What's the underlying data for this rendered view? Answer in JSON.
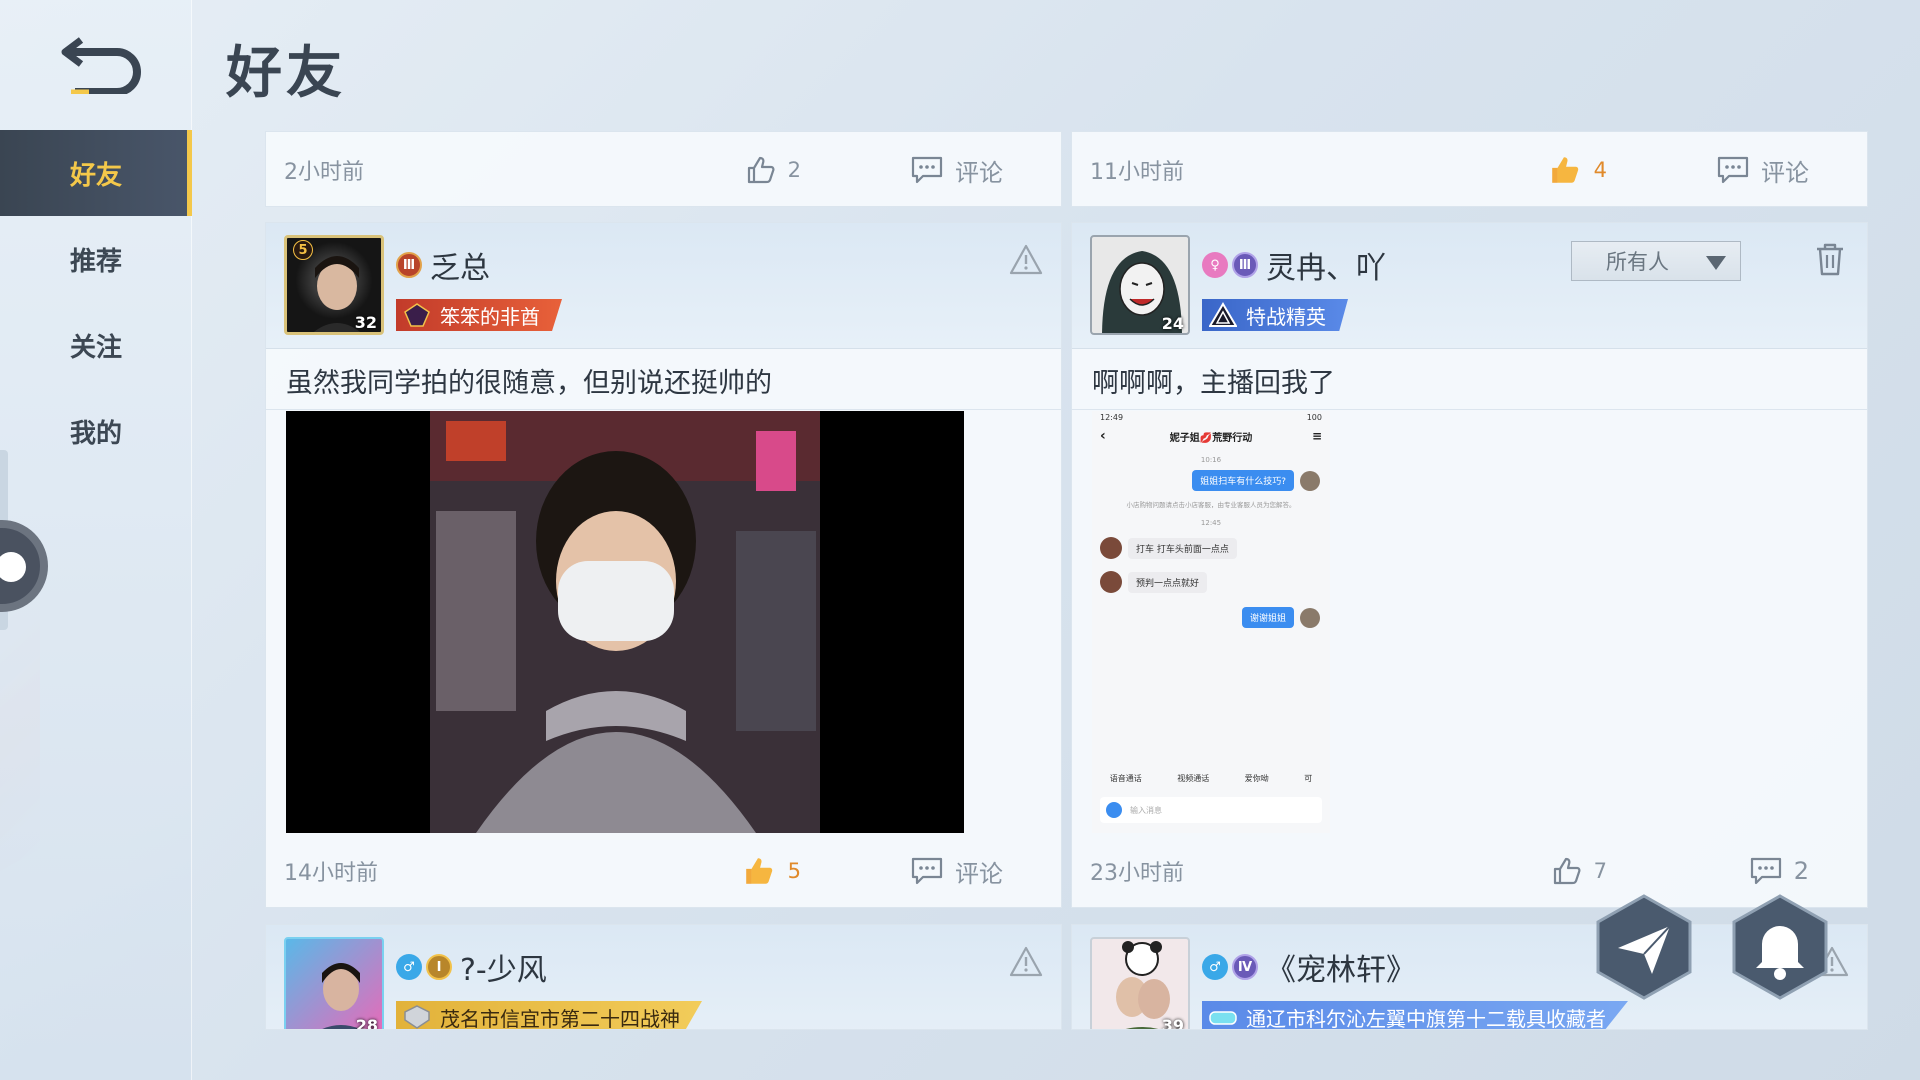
{
  "page": {
    "title": "好友"
  },
  "nav": {
    "items": [
      {
        "label": "好友",
        "active": true
      },
      {
        "label": "推荐",
        "active": false
      },
      {
        "label": "关注",
        "active": false
      },
      {
        "label": "我的",
        "active": false
      }
    ]
  },
  "colors": {
    "accent": "#f4c84a",
    "like_active": "#e08a2b",
    "dark": "#3a4552"
  },
  "top_cards": [
    {
      "time": "2小时前",
      "likes": "2",
      "liked": false,
      "comment_label": "评论"
    },
    {
      "time": "11小时前",
      "likes": "4",
      "liked": true,
      "comment_label": "评论"
    }
  ],
  "posts": [
    {
      "username": "乏总",
      "avatar_level": "32",
      "avatar_rank": "5",
      "title_badge": "笨笨的非酋",
      "text": "虽然我同学拍的很随意，但别说还挺帅的",
      "time": "14小时前",
      "likes": "5",
      "liked": true,
      "comment_label": "评论"
    },
    {
      "username": "灵冉、吖",
      "avatar_level": "24",
      "title_badge": "特战精英",
      "visibility": "所有人",
      "text": "啊啊啊，主播回我了",
      "time": "23小时前",
      "likes": "7",
      "liked": false,
      "comments": "2",
      "screenshot": {
        "status_time": "12:49",
        "status_right": "100",
        "chat_title": "妮子姐💋荒野行动",
        "time1": "10:16",
        "msg1": "姐姐扫车有什么技巧?",
        "system_note": "小店购物问题请点击小店客服，由专业客服人员为您解答。",
        "time2": "12:45",
        "reply1": "打车 打车头前面一点点",
        "reply2": "预判一点点就好",
        "msg2": "谢谢姐姐",
        "tool1": "语音通话",
        "tool2": "视频通话",
        "tool3": "爱你呦",
        "tool4": "可",
        "input_placeholder": "输入消息"
      }
    },
    {
      "username": "?-少风",
      "avatar_level": "28",
      "title_badge": "茂名市信宜市第二十四战神"
    },
    {
      "username": "《宠林轩》",
      "avatar_level": "39",
      "title_badge": "通辽市科尔沁左翼中旗第十二载具收藏者"
    }
  ],
  "icons": {
    "back": "back-arrow-icon",
    "like": "thumbs-up-icon",
    "comment": "comment-bubble-icon",
    "report": "warning-triangle-icon",
    "trash": "trash-icon",
    "send": "paper-plane-icon",
    "bell": "bell-icon"
  }
}
